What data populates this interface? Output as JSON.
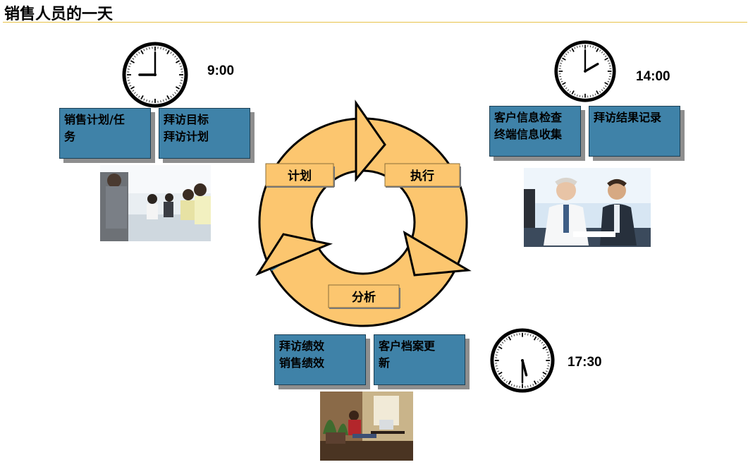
{
  "page": {
    "title": "销售人员的一天"
  },
  "cycle": {
    "labels": {
      "plan": "计划",
      "execute": "执行",
      "analyze": "分析"
    },
    "colors": {
      "ring": "#fcc66f",
      "tab": "#fcc66f",
      "accent": "#3f82a8"
    }
  },
  "morning": {
    "time": "9:00",
    "box1": {
      "line1": "销售计划/任",
      "line2": "务"
    },
    "box2": {
      "line1": "拜访目标",
      "line2": "拜访计划"
    },
    "clock": {
      "hour": 9,
      "minute": 0
    },
    "photo": "meeting-photo"
  },
  "afternoon": {
    "time": "14:00",
    "box1": {
      "line1": "客户信息检查",
      "line2": "终端信息收集"
    },
    "box2": {
      "line1": "拜访结果记录",
      "line2": ""
    },
    "clock": {
      "hour": 2,
      "minute": 0
    },
    "photo": "client-meeting-photo"
  },
  "evening": {
    "time": "17:30",
    "box1": {
      "line1": "拜访绩效",
      "line2": "销售绩效"
    },
    "box2": {
      "line1": "客户档案更",
      "line2": "新"
    },
    "clock": {
      "hour": 5,
      "minute": 30
    },
    "photo": "home-office-photo"
  }
}
